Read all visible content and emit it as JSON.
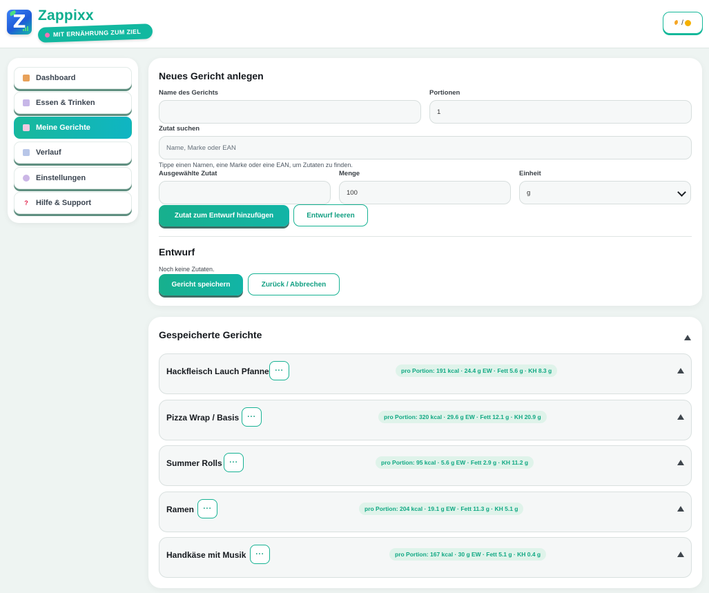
{
  "header": {
    "brand": "Zappixx",
    "tagline": "MIT ERNÄHRUNG ZUM ZIEL",
    "theme_toggle": "/",
    "icons": {
      "logo": "zappixx-logo",
      "moon": "moon-icon",
      "sun": "sun-icon"
    }
  },
  "sidebar": {
    "items": [
      {
        "label": "Dashboard",
        "icon": "house-icon",
        "active": false
      },
      {
        "label": "Essen & Trinken",
        "icon": "calendar-icon",
        "active": false
      },
      {
        "label": "Meine Gerichte",
        "icon": "notepad-icon",
        "active": true
      },
      {
        "label": "Verlauf",
        "icon": "chart-icon",
        "active": false
      },
      {
        "label": "Einstellungen",
        "icon": "gear-icon",
        "active": false
      },
      {
        "label": "Hilfe & Support",
        "icon": "question-icon",
        "active": false
      }
    ]
  },
  "new_dish": {
    "title": "Neues Gericht anlegen",
    "name_label": "Name des Gerichts",
    "name_value": "",
    "portions_label": "Portionen",
    "portions_value": "1",
    "search_label": "Zutat suchen",
    "search_placeholder": "Name, Marke oder EAN",
    "search_hint": "Tippe einen Namen, eine Marke oder eine EAN, um Zutaten zu finden.",
    "selected_label": "Ausgewählte Zutat",
    "selected_value": "",
    "amount_label": "Menge",
    "amount_value": "100",
    "unit_label": "Einheit",
    "unit_value": "g",
    "add_button": "Zutat zum Entwurf hinzufügen",
    "clear_button": "Entwurf leeren",
    "draft_title": "Entwurf",
    "draft_empty": "Noch keine Zutaten.",
    "save_button": "Gericht speichern",
    "back_button": "Zurück / Abbrechen"
  },
  "saved": {
    "title": "Gespeicherte Gerichte",
    "more_label": "···",
    "recipes": [
      {
        "name": "Hackfleisch Lauch Pfanne",
        "macros": "pro Portion: 191 kcal · 24.4 g EW · Fett 5.6 g · KH 8.3 g"
      },
      {
        "name": "Pizza Wrap / Basis",
        "macros": "pro Portion: 320 kcal · 29.6 g EW · Fett 12.1 g · KH 20.9 g"
      },
      {
        "name": "Summer Rolls",
        "macros": "pro Portion: 95 kcal · 5.6 g EW · Fett 2.9 g · KH 11.2 g"
      },
      {
        "name": "Ramen",
        "macros": "pro Portion: 204 kcal · 19.1 g EW · Fett 11.3 g · KH 5.1 g"
      },
      {
        "name": "Handkäse mit Musik",
        "macros": "pro Portion: 167 kcal · 30 g EW · Fett 5.1 g · KH 0.4 g"
      }
    ]
  },
  "colors": {
    "accent": "#16b293",
    "accent_dark": "#119f82",
    "pill_bg": "#dff3ea",
    "page_bg": "#eef4f2"
  }
}
